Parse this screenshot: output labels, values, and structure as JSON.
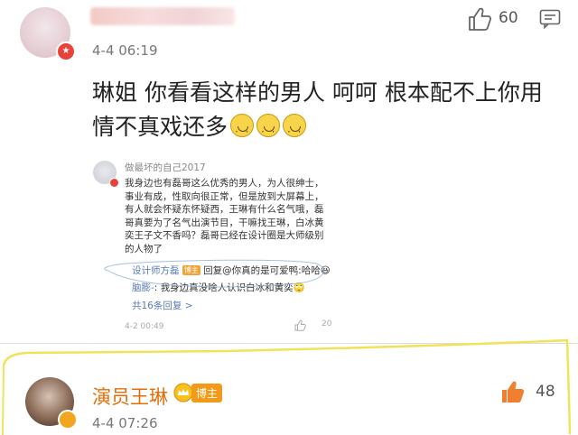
{
  "top_comment": {
    "username": "",
    "timestamp": "4-4 06:19",
    "likes": "60",
    "text": "琳姐 你看看这样的男人 呵呵 根本配不上你用情不真戏还多",
    "emoji_count": 3,
    "icons": [
      "like-icon",
      "reply-icon"
    ]
  },
  "embedded_screenshot": {
    "username": "做最坏的自己2017",
    "body": "我身边也有磊哥这么优秀的男人，为人很绅士，\n事业有成，性取向很正常，但是放到大屏幕上，\n有人就会怀疑东怀疑西，王琳有什么名气哦，磊\n哥真要为了名气出演节目，干嘛找王琳，白冰黄\n奕王子文不香吗？磊哥已经在设计圈是大师级别\n的人物了",
    "reply1_user": "设计师方磊",
    "reply1_badge": "博主",
    "reply1_text": " 回复@你真的是可爱鸭:哈哈",
    "reply2_user": "脑膨-",
    "reply2_text": ": 我身边真没啥人认识白冰和黄奕",
    "total_replies": "共16条回复 >",
    "timestamp": "4-2 00:49",
    "likes": "20"
  },
  "bottom_comment": {
    "username": "演员王琳",
    "badge": "博主",
    "timestamp": "4-4 07:26",
    "likes": "48"
  },
  "colors": {
    "highlight": "#f2e25a",
    "name_orange": "#e06f0a",
    "badge_orange": "#f39b18",
    "verified_red": "#e8423b",
    "link_blue": "#5a7bb5"
  }
}
